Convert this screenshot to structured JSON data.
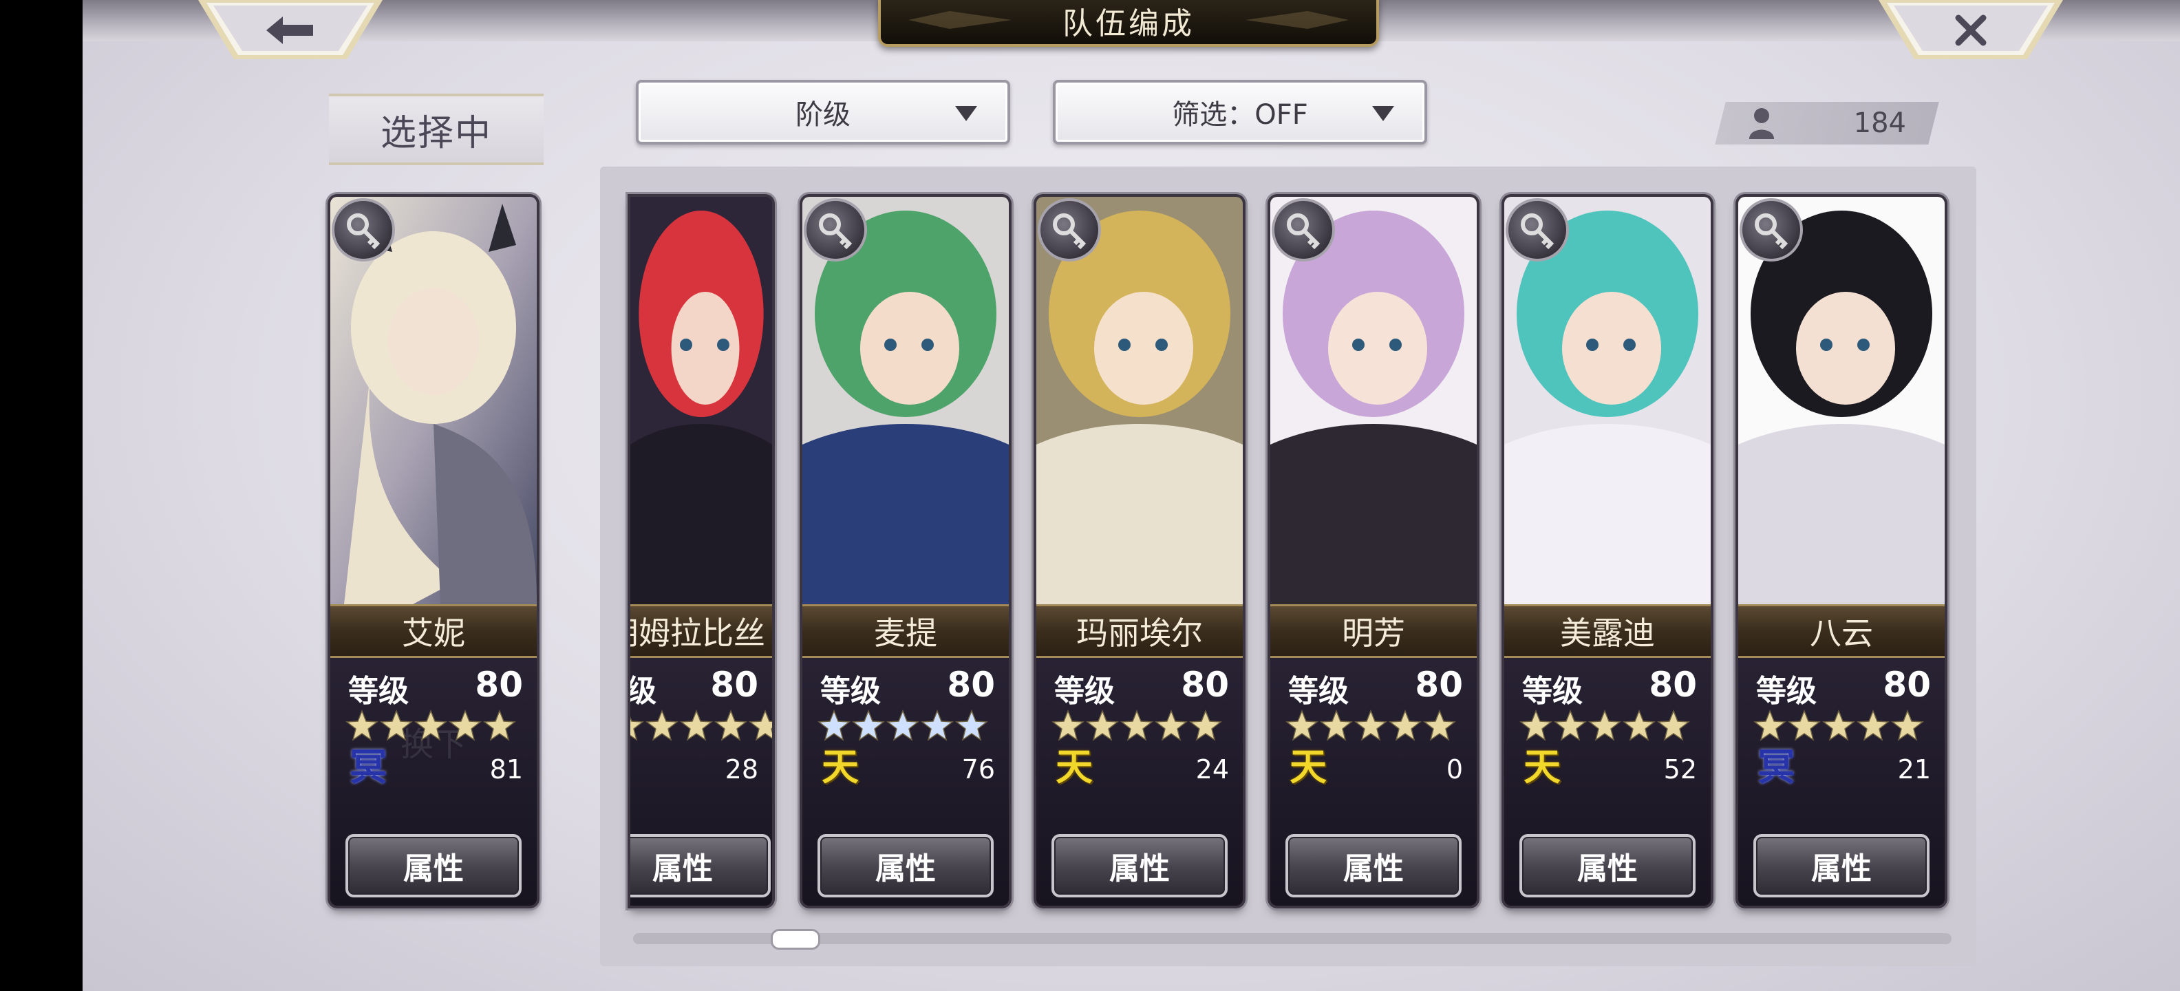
{
  "header": {
    "title": "队伍编成"
  },
  "selecting": {
    "label": "选择中",
    "swap_label": "换下"
  },
  "filters": {
    "rank_label": "阶级",
    "filter_label": "筛选：OFF"
  },
  "unit_count": "184",
  "attribute_button_label": "属性",
  "level_label": "等级",
  "colors": {
    "heaven_realm": "#f2d82a",
    "dark_realm": "#2733a8",
    "gold_star": "#e8d9a3",
    "blue_star": "#cfe0ff"
  },
  "selected_unit": {
    "name": "艾妮",
    "level": "80",
    "stars": 5,
    "star_color": "gold",
    "realm": "冥",
    "realm_value": "81"
  },
  "units": [
    {
      "name": "胡姆拉比丝",
      "level_label": "级",
      "level": "80",
      "stars": 5,
      "star_color": "gold",
      "realm": "",
      "realm_value": "28"
    },
    {
      "name": "麦提",
      "level_label": "等级",
      "level": "80",
      "stars": 5,
      "star_color": "blue",
      "realm": "天",
      "realm_value": "76"
    },
    {
      "name": "玛丽埃尔",
      "level_label": "等级",
      "level": "80",
      "stars": 5,
      "star_color": "gold",
      "realm": "天",
      "realm_value": "24"
    },
    {
      "name": "明芳",
      "level_label": "等级",
      "level": "80",
      "stars": 5,
      "star_color": "gold",
      "realm": "天",
      "realm_value": "0"
    },
    {
      "name": "美露迪",
      "level_label": "等级",
      "level": "80",
      "stars": 5,
      "star_color": "gold",
      "realm": "天",
      "realm_value": "52"
    },
    {
      "name": "八云",
      "level_label": "等级",
      "level": "80",
      "stars": 5,
      "star_color": "gold",
      "realm": "冥",
      "realm_value": "21"
    }
  ]
}
